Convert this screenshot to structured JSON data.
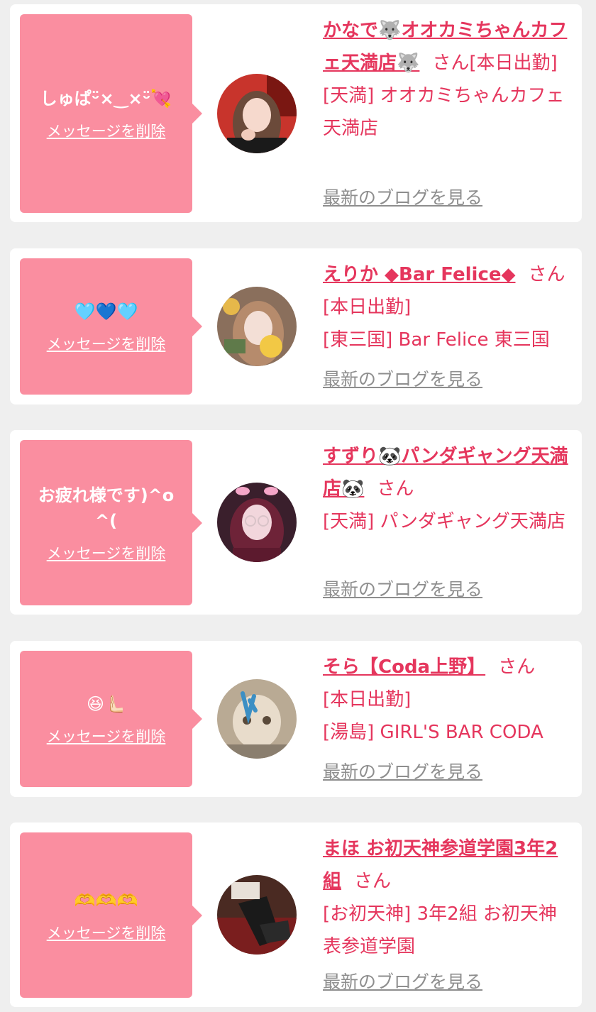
{
  "messages": [
    {
      "message": "しゅぱᵕ̈×‿×ᵕ̈💘",
      "delete_label": "メッセージを削除",
      "name": "かなで🐺オオカミちゃんカフェ天満店🐺",
      "honorific": "さん",
      "status": "[本日出勤]",
      "shop": "[天満] オオカミちゃんカフェ天満店",
      "blog_link": "最新のブログを見る",
      "avatar_icon": "profile-photo-girl-red-background"
    },
    {
      "message": "🩵💙🩵",
      "delete_label": "メッセージを削除",
      "name": "えりか ◆Bar Felice◆",
      "honorific": "さん",
      "status": "[本日出勤]",
      "shop": "[東三国] Bar Felice 東三国",
      "blog_link": "最新のブログを見る",
      "avatar_icon": "profile-photo-girl-stickers"
    },
    {
      "message": "お疲れ様です)^o^(",
      "delete_label": "メッセージを削除",
      "name": "すずり🐼パンダギャング天満店🐼",
      "honorific": "さん",
      "status": "",
      "shop": "[天満] パンダギャング天満店",
      "blog_link": "最新のブログを見る",
      "avatar_icon": "profile-photo-girl-glasses"
    },
    {
      "message": "😆🫷🏻",
      "delete_label": "メッセージを削除",
      "name": "そら【Coda上野】",
      "honorific": "さん",
      "status": "[本日出勤]",
      "shop": "[湯島] GIRL'S BAR CODA",
      "blog_link": "最新のブログを見る",
      "avatar_icon": "profile-photo-plush-toy"
    },
    {
      "message": "🫶🫶🫶",
      "delete_label": "メッセージを削除",
      "name": "まほ お初天神参道学園3年2組",
      "honorific": "さん",
      "status": "",
      "shop": "[お初天神] 3年2組 お初天神表参道学園",
      "blog_link": "最新のブログを見る",
      "avatar_icon": "profile-photo-legs-stockings"
    }
  ],
  "colors": {
    "accent": "#e5365d",
    "bubble": "#fa8ea0",
    "card": "#ffffff",
    "background": "#efefef",
    "muted": "#8e8e8e"
  }
}
